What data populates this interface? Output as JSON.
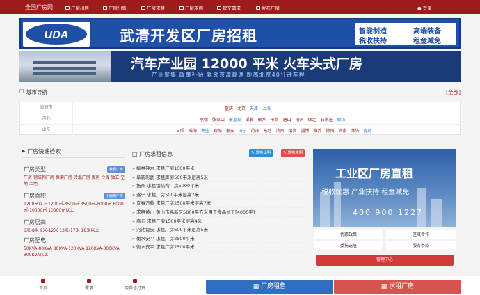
{
  "topnav": {
    "brand": "全国厂房网",
    "items": [
      "厂房出租",
      "厂房出售",
      "厂房求租",
      "厂房求购",
      "提交需求",
      "发布厂房"
    ],
    "login": "登录"
  },
  "banner1": {
    "logo_text": "UDA",
    "title": "武清开发区厂房招租",
    "tags": [
      "智能制造",
      "高端装备",
      "税收扶持",
      "租金减免"
    ]
  },
  "banner2": {
    "title": "汽车产业园 12000 平米 火车头式厂房",
    "subtitle": "产业聚集   政策补贴   紧邻京津高速   距离北京40分钟车程"
  },
  "city_nav": {
    "title": "城市导航",
    "all_label": "[全部]",
    "rows": [
      {
        "label": "直辖市",
        "cities": [
          "重庆",
          "北京",
          "天津",
          "上海"
        ]
      },
      {
        "label": "河北",
        "cities": [
          "承德",
          "张家口",
          "秦皇岛",
          "邯郸",
          "衡水",
          "邢台",
          "唐山",
          "沧州",
          "保定",
          "石家庄",
          "廊坊"
        ]
      },
      {
        "label": "山东",
        "cities": [
          "日照",
          "威海",
          "枣庄",
          "聊城",
          "泰安",
          "济宁",
          "菏泽",
          "东营",
          "滨州",
          "烟台",
          "淄博",
          "临沂",
          "德州",
          "济南",
          "潍坊",
          "青岛"
        ]
      }
    ]
  },
  "quick_search": {
    "title": "厂房快速检索",
    "groups": [
      {
        "title": "厂房类型",
        "badge": "我要厂房",
        "values": "厂房 钢结构厂房 框架厂房 砖混厂房 库房 冷库 独立 空地 土地"
      },
      {
        "title": "厂房面积",
        "badge": "小面积厂房",
        "values": "1200㎡以下 1200㎡-3500㎡ 3500㎡-6000㎡ 6000㎡-10000㎡ 10000㎡以上"
      },
      {
        "title": "厂房层高",
        "values": "6米-8米 9米-12米 13米-17米 18米以上"
      },
      {
        "title": "厂房配电",
        "values": "50KVA-80KVA 80KVA-120KVA 120KVA-300KVA 300KVA以上"
      }
    ]
  },
  "rent_info": {
    "title": "厂房求租信息",
    "post_rent_btn": "发布出租",
    "post_want_btn": "发布求租",
    "items": [
      "榆林神木 求租厂房1000平米",
      "阜新彰武 求租库房500平米层高5米",
      "扬州 求租钢结构厂房5000平米",
      "遂宁 求租厂房500平米层高7米",
      "宜春万载 求租厂房2500平米层高7米",
      "求租黄山 黄山市高新区5000平方米用于食品加工[4000平]",
      "商丘 求租厂房1500平米层高4米",
      "河池都安 求租厂房600平米层高5米",
      "衡水安平 求租厂房2500平米",
      "衡水安平 求租厂房2500平米"
    ]
  },
  "side_ad": {
    "title": "工业区厂房直租",
    "subtitle": "税收优惠  产业扶持  租金减免",
    "phone": "400 900 1227",
    "links": [
      "优惠政策",
      "区域合作",
      "委托选址",
      "服务条款"
    ],
    "manage": "管理中心"
  },
  "bottombar": {
    "items": [
      "首页",
      "需求",
      "用微信打开"
    ],
    "rent_btn": "厂房租售",
    "want_btn": "求租厂房"
  },
  "colors": {
    "brand_red": "#9e1b1b",
    "blue": "#3a7bd5",
    "button_blue": "#2f6fc0",
    "button_red": "#d6534f"
  }
}
